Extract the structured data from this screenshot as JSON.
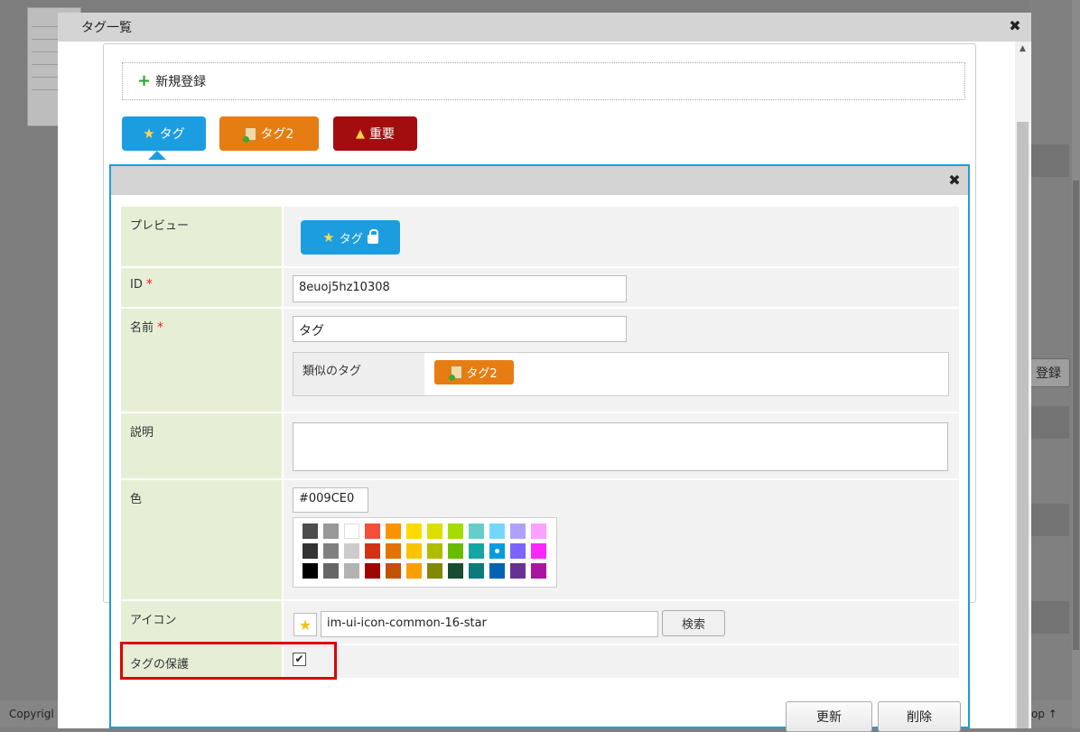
{
  "background": {
    "register_label": "登録",
    "footer_left": "Copyrigl",
    "footer_right": "op ↑"
  },
  "outer_dialog": {
    "title": "タグ一覧",
    "new_register_label": "新規登録",
    "tags": [
      {
        "label": "タグ",
        "color": "#1c9de0",
        "icon": "star-icon"
      },
      {
        "label": "タグ2",
        "color": "#e67d12",
        "icon": "document-add-icon"
      },
      {
        "label": "重要",
        "color": "#a30d0f",
        "icon": "warning-icon"
      }
    ]
  },
  "editor": {
    "preview": {
      "label": "プレビュー",
      "tag_label": "タグ"
    },
    "id": {
      "label": "ID",
      "required_mark": "*",
      "value": "8euoj5hz10308"
    },
    "name": {
      "label": "名前",
      "required_mark": "*",
      "value": "タグ"
    },
    "similar": {
      "label": "類似のタグ",
      "tag_label": "タグ2"
    },
    "description": {
      "label": "説明",
      "value": ""
    },
    "color": {
      "label": "色",
      "value": "#009CE0",
      "palette": [
        [
          "#4d4d4d",
          "#999999",
          "#ffffff",
          "#f44e3b",
          "#fe9200",
          "#fcdc00",
          "#dbdf00",
          "#a4dd00",
          "#68ccca",
          "#73d8ff",
          "#aea1ff",
          "#fda1ff"
        ],
        [
          "#333333",
          "#808080",
          "#cccccc",
          "#d33115",
          "#e27300",
          "#fcc400",
          "#b0bc00",
          "#68bc00",
          "#16a5a5",
          "#009ce0",
          "#7b64ff",
          "#fa28ff"
        ],
        [
          "#000000",
          "#666666",
          "#b3b3b3",
          "#9f0500",
          "#c45100",
          "#fb9e00",
          "#808900",
          "#194d33",
          "#0c797d",
          "#0062b1",
          "#653294",
          "#ab149e"
        ]
      ],
      "selected": "#009ce0"
    },
    "icon": {
      "label": "アイコン",
      "value": "im-ui-icon-common-16-star",
      "search_label": "検索"
    },
    "protect": {
      "label": "タグの保護",
      "checked": true
    },
    "update_label": "更新",
    "delete_label": "削除"
  }
}
